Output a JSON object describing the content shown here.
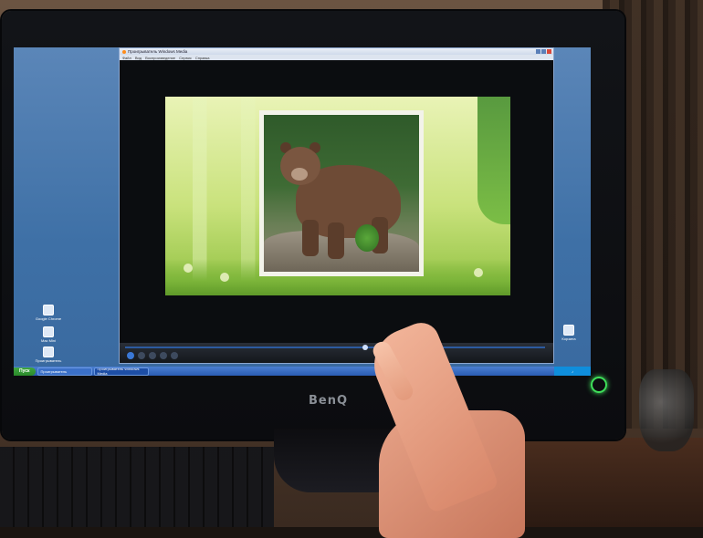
{
  "window": {
    "title": "Проигрыватель Windows Media"
  },
  "menu": [
    "Файл",
    "Вид",
    "Воспроизведение",
    "Сервис",
    "Справка"
  ],
  "monitor": {
    "brand": "BenQ"
  },
  "desktop_icons": [
    {
      "label": "Google Chrome",
      "icon": "chrome-icon"
    },
    {
      "label": "Mac Mini",
      "icon": "computer-icon"
    },
    {
      "label": "Проигрыватель",
      "icon": "media-icon"
    }
  ],
  "recycle_bin_label": "Корзина",
  "taskbar": {
    "start_label": "Пуск",
    "tasks": [
      "Проигрыватель",
      "Проигрыватель Windows Media"
    ],
    "tray_icons": [
      "volume-icon",
      "network-icon"
    ]
  },
  "colors": {
    "accent": "#3a78d6",
    "taskbar": "#2a5cb3",
    "power_led": "#3fe05a"
  }
}
